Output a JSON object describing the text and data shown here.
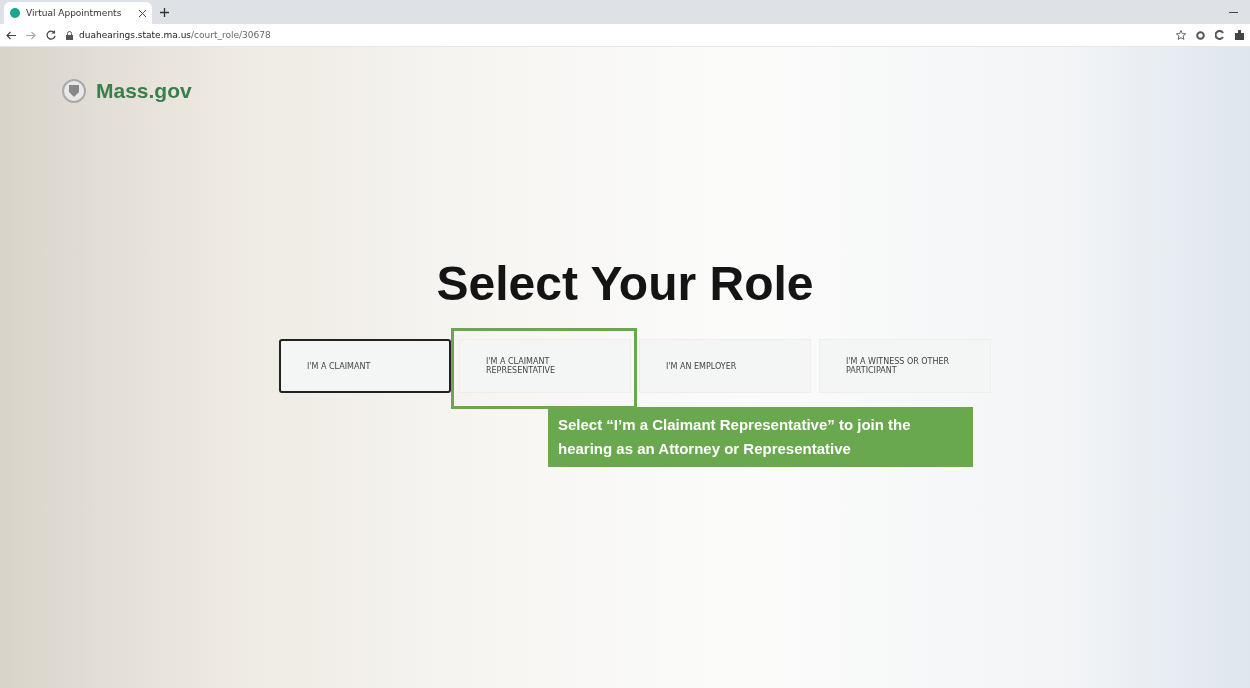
{
  "browser": {
    "tab_title": "Virtual Appointments",
    "url_domain": "duahearings.state.ma.us",
    "url_path": "/court_role/30678"
  },
  "header": {
    "logo_text": "Mass.gov"
  },
  "heading": "Select Your Role",
  "roles": [
    {
      "label": "I'M A CLAIMANT",
      "selected": true,
      "highlighted": false
    },
    {
      "label": "I'M A CLAIMANT REPRESENTATIVE",
      "selected": false,
      "highlighted": true
    },
    {
      "label": "I'M AN EMPLOYER",
      "selected": false,
      "highlighted": false
    },
    {
      "label": "I'M A WITNESS OR OTHER PARTICIPANT",
      "selected": false,
      "highlighted": false
    }
  ],
  "callout": "Select “I’m a Claimant Representative” to join the hearing as an Attorney or Representative"
}
